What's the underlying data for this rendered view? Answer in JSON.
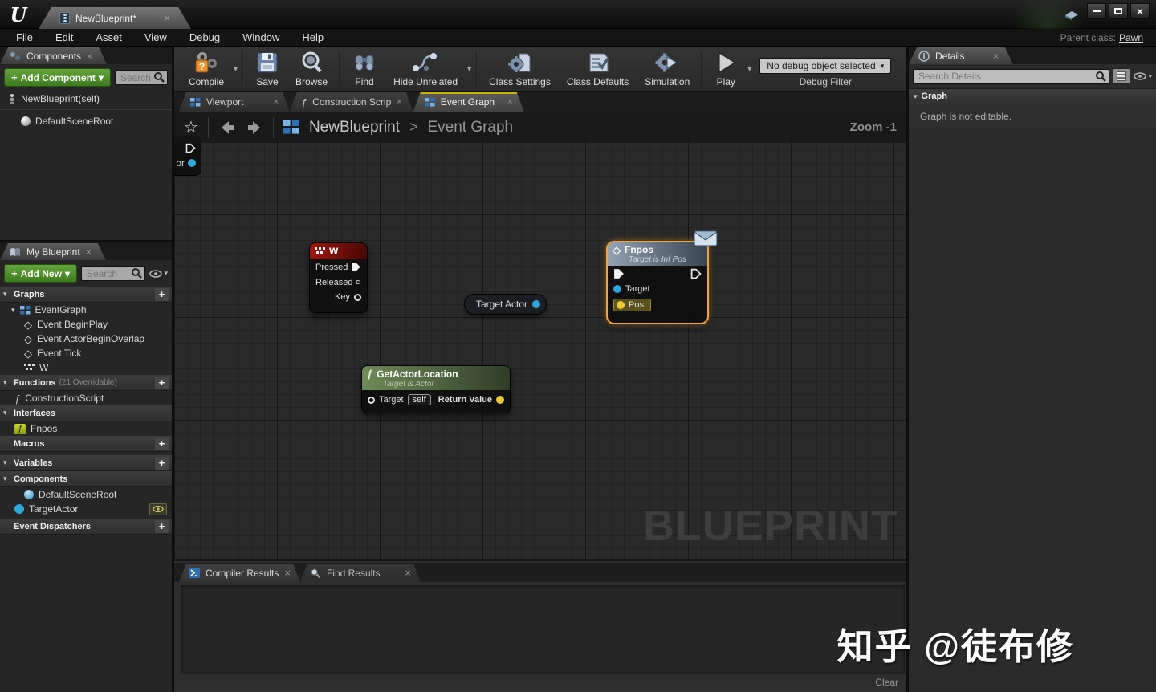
{
  "icons": {
    "close": "×",
    "caret_down": "▾",
    "plus": "+",
    "expanded": "▾",
    "diamond": "◇",
    "function_glyph": "ƒ",
    "star": "☆",
    "chevron": ">",
    "dash": "–"
  },
  "window": {
    "tab_title": "NewBlueprint*"
  },
  "menu": {
    "items": [
      "File",
      "Edit",
      "Asset",
      "View",
      "Debug",
      "Window",
      "Help"
    ],
    "parent_class_label": "Parent class:",
    "parent_class": "Pawn"
  },
  "toolbar": {
    "buttons": [
      "Compile",
      "Save",
      "Browse",
      "Find",
      "Hide Unrelated",
      "Class Settings",
      "Class Defaults",
      "Simulation",
      "Play"
    ],
    "debug_object": "No debug object selected",
    "debug_filter_label": "Debug Filter"
  },
  "components_panel": {
    "tab": "Components",
    "add_button": "Add Component",
    "search_placeholder": "Search",
    "root_item": "NewBlueprint(self)",
    "child_item": "DefaultSceneRoot"
  },
  "my_blueprint": {
    "tab": "My Blueprint",
    "add_button": "Add New",
    "search_placeholder": "Search",
    "graphs_header": "Graphs",
    "eventgraph": "EventGraph",
    "events": [
      "Event BeginPlay",
      "Event ActorBeginOverlap",
      "Event Tick",
      "W"
    ],
    "functions_header": "Functions",
    "functions_note": "(21 Overridable)",
    "construction_script": "ConstructionScript",
    "interfaces_header": "Interfaces",
    "interface_item": "Fnpos",
    "macros_header": "Macros",
    "variables_header": "Variables",
    "components_header": "Components",
    "component_items": [
      "DefaultSceneRoot",
      "TargetActor"
    ],
    "event_dispatchers_header": "Event Dispatchers"
  },
  "doc_tabs": {
    "viewport": "Viewport",
    "construction": "Construction Scrip",
    "event_graph": "Event Graph"
  },
  "graph": {
    "breadcrumb_root": "NewBlueprint",
    "breadcrumb_current": "Event Graph",
    "zoom_label": "Zoom -1",
    "watermark": "BLUEPRINT",
    "clipped_node_text": "or",
    "w_node": {
      "title": "W",
      "pressed": "Pressed",
      "released": "Released",
      "key": "Key"
    },
    "target_actor_node": {
      "label": "Target Actor"
    },
    "fnpos_node": {
      "title": "Fnpos",
      "subtitle": "Target is Inf Pos",
      "target": "Target",
      "pos": "Pos"
    },
    "location_node": {
      "title": "GetActorLocation",
      "subtitle": "Target is Actor",
      "target": "Target",
      "self_value": "self",
      "return_value": "Return Value"
    }
  },
  "details_panel": {
    "tab": "Details",
    "search_placeholder": "Search Details",
    "section": "Graph",
    "message": "Graph is not editable."
  },
  "bottom_panel": {
    "tabs": [
      "Compiler Results",
      "Find Results"
    ],
    "clear": "Clear"
  },
  "credit": "知乎 @徒布修",
  "colors": {
    "accent_green": "#4f9c1f",
    "selection_orange": "#f2a240",
    "pin_blue": "#2fa7dd",
    "pin_yellow": "#eec832",
    "exec_white": "#efefef",
    "node_header_red": "#a21309",
    "node_header_green": "#6f8b57",
    "node_header_blue": "#93a2b3",
    "tab_active_yellow": "#c8b400"
  }
}
